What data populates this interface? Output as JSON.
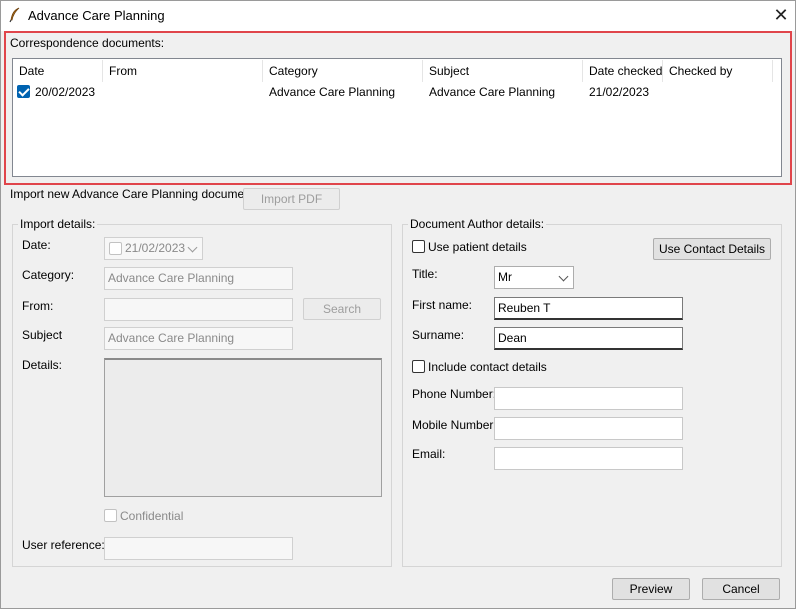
{
  "window": {
    "title": "Advance Care Planning",
    "close_icon": "close-icon"
  },
  "correspondence": {
    "label": "Correspondence documents:",
    "columns": [
      "Date",
      "From",
      "Category",
      "Subject",
      "Date checked",
      "Checked by"
    ],
    "rows": [
      {
        "checked": true,
        "date": "20/02/2023",
        "from": "",
        "category": "Advance Care Planning",
        "subject": "Advance Care Planning",
        "date_checked": "21/02/2023",
        "checked_by": ""
      }
    ]
  },
  "import_row": {
    "label": "Import new Advance Care Planning document",
    "import_button": "Import PDF"
  },
  "import_details": {
    "title": "Import details:",
    "date_label": "Date:",
    "date_value": "21/02/2023",
    "category_label": "Category:",
    "category_value": "Advance Care Planning",
    "from_label": "From:",
    "from_value": "",
    "search_button": "Search",
    "subject_label": "Subject",
    "subject_value": "Advance Care Planning",
    "details_label": "Details:",
    "confidential_label": "Confidential",
    "user_reference_label": "User reference:",
    "user_reference_value": ""
  },
  "author": {
    "title": "Document Author details:",
    "use_patient_label": "Use patient details",
    "use_contact_button": "Use Contact Details",
    "title_label": "Title:",
    "title_value": "Mr",
    "first_name_label": "First name:",
    "first_name_value": "Reuben T",
    "surname_label": "Surname:",
    "surname_value": "Dean",
    "include_contact_label": "Include contact details",
    "phone_label": "Phone Number:",
    "phone_value": "",
    "mobile_label": "Mobile Number:",
    "mobile_value": "",
    "email_label": "Email:",
    "email_value": ""
  },
  "footer": {
    "preview_button": "Preview",
    "cancel_button": "Cancel"
  },
  "colors": {
    "highlight": "#e0454b",
    "checkbox_checked": "#0063b1"
  }
}
